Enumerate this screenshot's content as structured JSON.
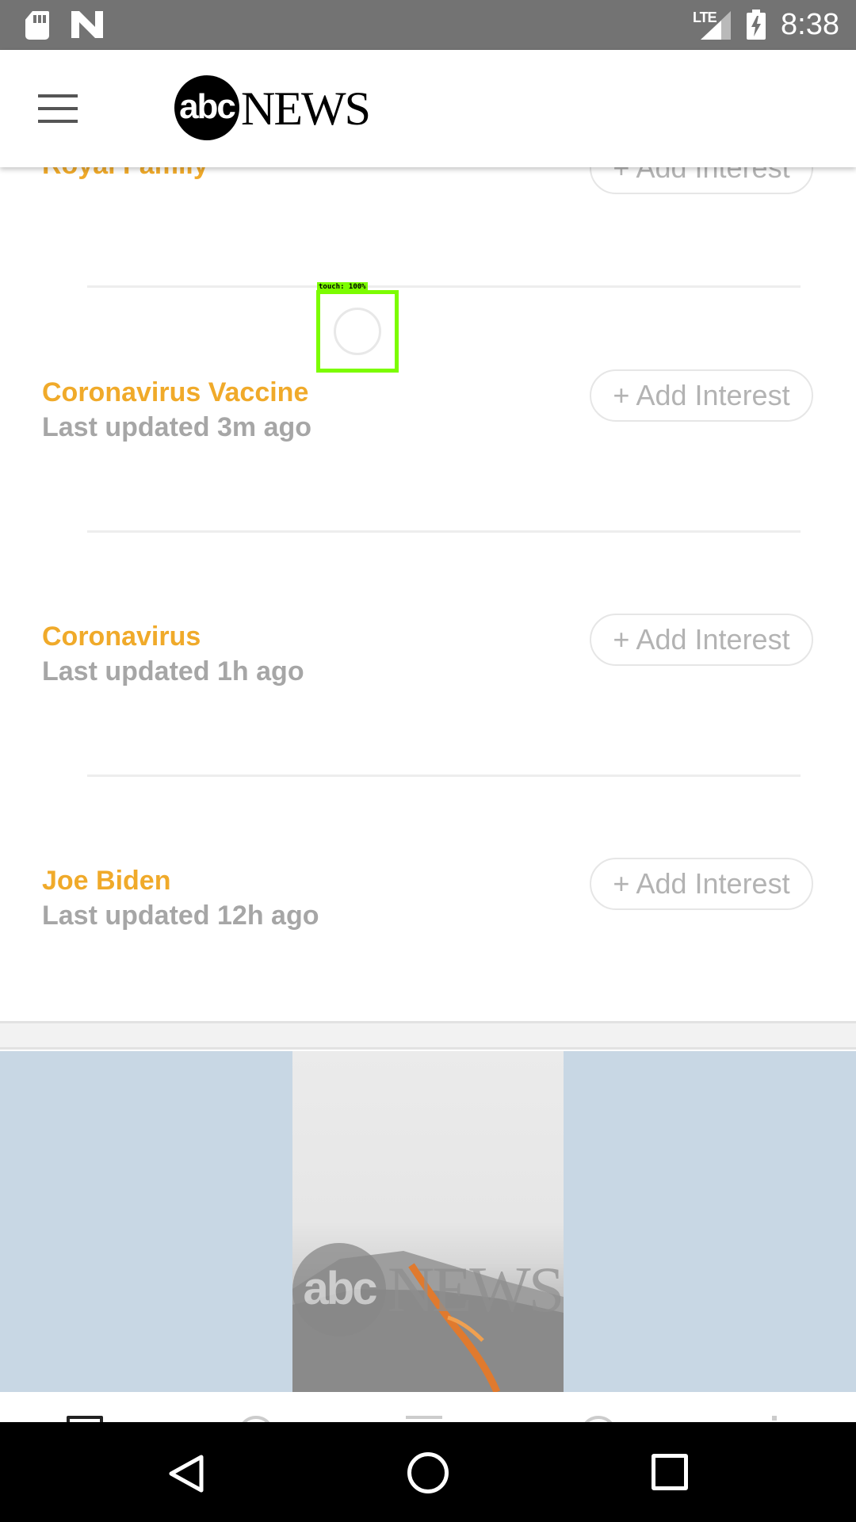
{
  "status_bar": {
    "time": "8:38",
    "network": "LTE",
    "icons": [
      "sd-card-icon",
      "n-notification-icon",
      "signal-icon",
      "battery-charging-icon"
    ]
  },
  "header": {
    "menu_icon": "hamburger-menu-icon",
    "logo_abc": "abc",
    "logo_news": "NEWS"
  },
  "interests": [
    {
      "title": "Royal Family",
      "updated": "",
      "button": "+ Add Interest"
    },
    {
      "title": "Coronavirus Vaccine",
      "updated": "Last updated 3m ago",
      "button": "+ Add Interest"
    },
    {
      "title": "Coronavirus",
      "updated": "Last updated 1h ago",
      "button": "+ Add Interest"
    },
    {
      "title": "Joe Biden",
      "updated": "Last updated 12h ago",
      "button": "+ Add Interest"
    }
  ],
  "touch_overlay": {
    "label": "touch: 100%"
  },
  "video": {
    "logo_abc": "abc",
    "logo_news": "NEWS"
  },
  "colors": {
    "accent": "#F0AA2A",
    "status_bar": "#737373",
    "ad_background": "#C8D7E4"
  },
  "nav_bar": {
    "icons": [
      "back-icon",
      "home-icon",
      "recents-icon"
    ]
  }
}
